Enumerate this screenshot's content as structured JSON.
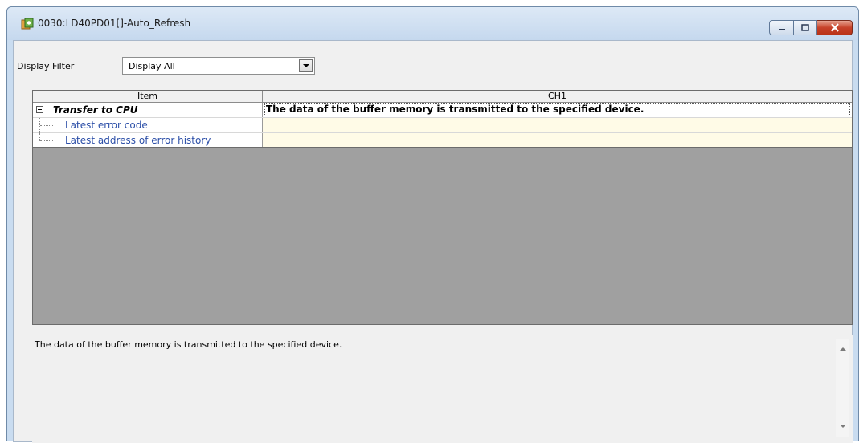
{
  "window": {
    "title": "0030:LD40PD01[]-Auto_Refresh",
    "icon": "module-settings-icon",
    "buttons": [
      "minimize",
      "maximize",
      "close"
    ]
  },
  "filter": {
    "label": "Display Filter",
    "selected": "Display All"
  },
  "grid": {
    "columns": [
      "Item",
      "CH1"
    ],
    "group": {
      "label": "Transfer to CPU",
      "value": "The data of the buffer memory is transmitted to the specified device."
    },
    "rows": [
      {
        "label": "Latest error code",
        "value": ""
      },
      {
        "label": "Latest address of error history",
        "value": ""
      }
    ]
  },
  "description": {
    "text": "The data of the buffer memory is transmitted to the specified device."
  },
  "colors": {
    "title_bg": "#c5d8ee",
    "grid_empty_bg": "#a0a0a0",
    "child_text": "#2c4fa8",
    "editable_cell_bg": "#fffbe7",
    "close_button": "#c7422a"
  }
}
